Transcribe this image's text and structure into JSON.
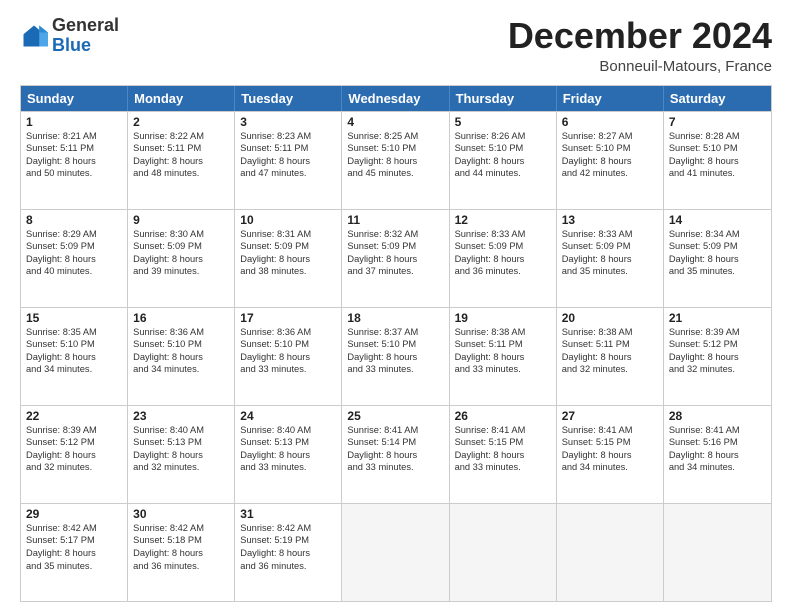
{
  "logo": {
    "general": "General",
    "blue": "Blue"
  },
  "title": "December 2024",
  "location": "Bonneuil-Matours, France",
  "days": [
    "Sunday",
    "Monday",
    "Tuesday",
    "Wednesday",
    "Thursday",
    "Friday",
    "Saturday"
  ],
  "weeks": [
    [
      {
        "day": 1,
        "lines": [
          "Sunrise: 8:21 AM",
          "Sunset: 5:11 PM",
          "Daylight: 8 hours",
          "and 50 minutes."
        ]
      },
      {
        "day": 2,
        "lines": [
          "Sunrise: 8:22 AM",
          "Sunset: 5:11 PM",
          "Daylight: 8 hours",
          "and 48 minutes."
        ]
      },
      {
        "day": 3,
        "lines": [
          "Sunrise: 8:23 AM",
          "Sunset: 5:11 PM",
          "Daylight: 8 hours",
          "and 47 minutes."
        ]
      },
      {
        "day": 4,
        "lines": [
          "Sunrise: 8:25 AM",
          "Sunset: 5:10 PM",
          "Daylight: 8 hours",
          "and 45 minutes."
        ]
      },
      {
        "day": 5,
        "lines": [
          "Sunrise: 8:26 AM",
          "Sunset: 5:10 PM",
          "Daylight: 8 hours",
          "and 44 minutes."
        ]
      },
      {
        "day": 6,
        "lines": [
          "Sunrise: 8:27 AM",
          "Sunset: 5:10 PM",
          "Daylight: 8 hours",
          "and 42 minutes."
        ]
      },
      {
        "day": 7,
        "lines": [
          "Sunrise: 8:28 AM",
          "Sunset: 5:10 PM",
          "Daylight: 8 hours",
          "and 41 minutes."
        ]
      }
    ],
    [
      {
        "day": 8,
        "lines": [
          "Sunrise: 8:29 AM",
          "Sunset: 5:09 PM",
          "Daylight: 8 hours",
          "and 40 minutes."
        ]
      },
      {
        "day": 9,
        "lines": [
          "Sunrise: 8:30 AM",
          "Sunset: 5:09 PM",
          "Daylight: 8 hours",
          "and 39 minutes."
        ]
      },
      {
        "day": 10,
        "lines": [
          "Sunrise: 8:31 AM",
          "Sunset: 5:09 PM",
          "Daylight: 8 hours",
          "and 38 minutes."
        ]
      },
      {
        "day": 11,
        "lines": [
          "Sunrise: 8:32 AM",
          "Sunset: 5:09 PM",
          "Daylight: 8 hours",
          "and 37 minutes."
        ]
      },
      {
        "day": 12,
        "lines": [
          "Sunrise: 8:33 AM",
          "Sunset: 5:09 PM",
          "Daylight: 8 hours",
          "and 36 minutes."
        ]
      },
      {
        "day": 13,
        "lines": [
          "Sunrise: 8:33 AM",
          "Sunset: 5:09 PM",
          "Daylight: 8 hours",
          "and 35 minutes."
        ]
      },
      {
        "day": 14,
        "lines": [
          "Sunrise: 8:34 AM",
          "Sunset: 5:09 PM",
          "Daylight: 8 hours",
          "and 35 minutes."
        ]
      }
    ],
    [
      {
        "day": 15,
        "lines": [
          "Sunrise: 8:35 AM",
          "Sunset: 5:10 PM",
          "Daylight: 8 hours",
          "and 34 minutes."
        ]
      },
      {
        "day": 16,
        "lines": [
          "Sunrise: 8:36 AM",
          "Sunset: 5:10 PM",
          "Daylight: 8 hours",
          "and 34 minutes."
        ]
      },
      {
        "day": 17,
        "lines": [
          "Sunrise: 8:36 AM",
          "Sunset: 5:10 PM",
          "Daylight: 8 hours",
          "and 33 minutes."
        ]
      },
      {
        "day": 18,
        "lines": [
          "Sunrise: 8:37 AM",
          "Sunset: 5:10 PM",
          "Daylight: 8 hours",
          "and 33 minutes."
        ]
      },
      {
        "day": 19,
        "lines": [
          "Sunrise: 8:38 AM",
          "Sunset: 5:11 PM",
          "Daylight: 8 hours",
          "and 33 minutes."
        ]
      },
      {
        "day": 20,
        "lines": [
          "Sunrise: 8:38 AM",
          "Sunset: 5:11 PM",
          "Daylight: 8 hours",
          "and 32 minutes."
        ]
      },
      {
        "day": 21,
        "lines": [
          "Sunrise: 8:39 AM",
          "Sunset: 5:12 PM",
          "Daylight: 8 hours",
          "and 32 minutes."
        ]
      }
    ],
    [
      {
        "day": 22,
        "lines": [
          "Sunrise: 8:39 AM",
          "Sunset: 5:12 PM",
          "Daylight: 8 hours",
          "and 32 minutes."
        ]
      },
      {
        "day": 23,
        "lines": [
          "Sunrise: 8:40 AM",
          "Sunset: 5:13 PM",
          "Daylight: 8 hours",
          "and 32 minutes."
        ]
      },
      {
        "day": 24,
        "lines": [
          "Sunrise: 8:40 AM",
          "Sunset: 5:13 PM",
          "Daylight: 8 hours",
          "and 33 minutes."
        ]
      },
      {
        "day": 25,
        "lines": [
          "Sunrise: 8:41 AM",
          "Sunset: 5:14 PM",
          "Daylight: 8 hours",
          "and 33 minutes."
        ]
      },
      {
        "day": 26,
        "lines": [
          "Sunrise: 8:41 AM",
          "Sunset: 5:15 PM",
          "Daylight: 8 hours",
          "and 33 minutes."
        ]
      },
      {
        "day": 27,
        "lines": [
          "Sunrise: 8:41 AM",
          "Sunset: 5:15 PM",
          "Daylight: 8 hours",
          "and 34 minutes."
        ]
      },
      {
        "day": 28,
        "lines": [
          "Sunrise: 8:41 AM",
          "Sunset: 5:16 PM",
          "Daylight: 8 hours",
          "and 34 minutes."
        ]
      }
    ],
    [
      {
        "day": 29,
        "lines": [
          "Sunrise: 8:42 AM",
          "Sunset: 5:17 PM",
          "Daylight: 8 hours",
          "and 35 minutes."
        ]
      },
      {
        "day": 30,
        "lines": [
          "Sunrise: 8:42 AM",
          "Sunset: 5:18 PM",
          "Daylight: 8 hours",
          "and 36 minutes."
        ]
      },
      {
        "day": 31,
        "lines": [
          "Sunrise: 8:42 AM",
          "Sunset: 5:19 PM",
          "Daylight: 8 hours",
          "and 36 minutes."
        ]
      },
      null,
      null,
      null,
      null
    ]
  ]
}
